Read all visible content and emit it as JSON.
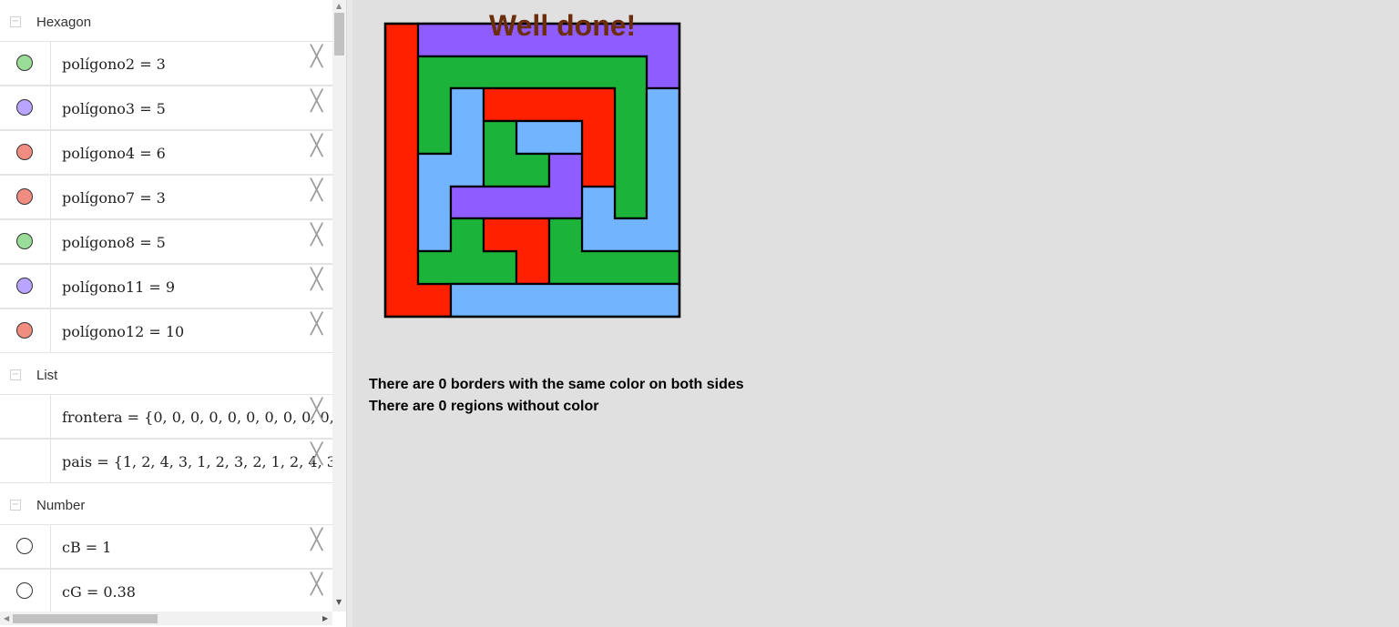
{
  "algebra": {
    "groups": {
      "hexagon": {
        "title": "Hexagon"
      },
      "list": {
        "title": "List"
      },
      "number": {
        "title": "Number"
      }
    },
    "hexagon_items": [
      {
        "expr": "polígono2 = 3",
        "color": "#99dd99"
      },
      {
        "expr": "polígono3 = 5",
        "color": "#b9a4ff"
      },
      {
        "expr": "polígono4 = 6",
        "color": "#f08c80"
      },
      {
        "expr": "polígono7 = 3",
        "color": "#f08c80"
      },
      {
        "expr": "polígono8 = 5",
        "color": "#99dd99"
      },
      {
        "expr": "polígono11 = 9",
        "color": "#b9a4ff"
      },
      {
        "expr": "polígono12 = 10",
        "color": "#f08c80"
      }
    ],
    "list_items": [
      {
        "expr": "frontera = {0, 0, 0, 0, 0, 0, 0, 0, 0, 0, 0"
      },
      {
        "expr": "pais = {1, 2, 4, 3, 1, 2, 3, 2, 1, 2, 4, 3,"
      }
    ],
    "number_items": [
      {
        "expr": "cB = 1",
        "color": "#ffffff"
      },
      {
        "expr": "cG = 0.38",
        "color": "#ffffff"
      }
    ],
    "close_glyph": "╳"
  },
  "graphics": {
    "title": "Well done!",
    "message1": "There are 0 borders with the same color on both sides",
    "message2": "There are 0 regions without color"
  },
  "colors": {
    "red": "#ff2000",
    "purple": "#8e5cff",
    "green": "#1cb33a",
    "blue": "#73b4ff"
  }
}
